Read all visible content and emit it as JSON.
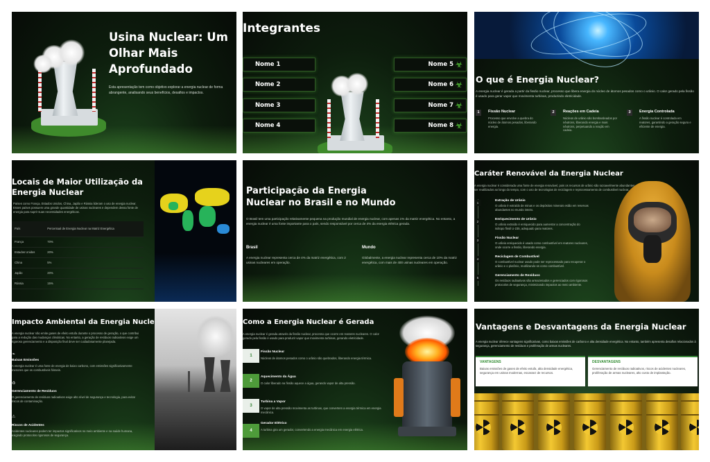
{
  "slides": {
    "s1": {
      "title": "Usina Nuclear: Um Olhar Mais Aprofundado",
      "subtitle": "Esta apresentação tem como objetivo explorar a energia nuclear de forma abrangente, analisando seus benefícios, desafios e impactos."
    },
    "s2": {
      "title": "Integrantes",
      "names": [
        "Nome 1",
        "Nome 2",
        "Nome 3",
        "Nome 4",
        "Nome 5",
        "Nome 6",
        "Nome 7",
        "Nome 8"
      ]
    },
    "s3": {
      "title": "O que é Energia Nuclear?",
      "desc": "A energia nuclear é gerada a partir da fissão nuclear, processo que libera energia do núcleo de átomos pesados como o urânio. O calor gerado pela fissão é usado para gerar vapor que movimenta turbinas, produzindo eletricidade.",
      "items": [
        {
          "n": "1",
          "h": "Fissão Nuclear",
          "d": "Processo que envolve a quebra do núcleo de átomos pesados, liberando energia."
        },
        {
          "n": "2",
          "h": "Reações em Cadeia",
          "d": "Núcleos de urânio são bombardeados por nêutrons, liberando energia e mais nêutrons, perpetuando a reação em cadeia."
        },
        {
          "n": "3",
          "h": "Energia Controlada",
          "d": "A fissão nuclear é controlada em reatores, garantindo a geração segura e eficiente de energia."
        }
      ]
    },
    "s4": {
      "title": "Locais de Maior Utilização da Energia Nuclear",
      "desc": "Países como França, Estados Unidos, China, Japão e Rússia lideram o uso de energia nuclear. Esses países possuem uma grande quantidade de usinas nucleares e dependem dessa fonte de energia para suprir suas necessidades energéticas.",
      "col1": "País",
      "col2": "Percentual de Energia Nuclear na Matriz Energética",
      "rows": [
        [
          "França",
          "70%"
        ],
        [
          "Estados Unidos",
          "20%"
        ],
        [
          "China",
          "5%"
        ],
        [
          "Japão",
          "20%"
        ],
        [
          "Rússia",
          "15%"
        ]
      ]
    },
    "s5": {
      "title": "Participação da Energia Nuclear no Brasil e no Mundo",
      "desc": "O Brasil tem uma participação relativamente pequena na produção mundial de energia nuclear, com apenas 1% da matriz energética. No entanto, a energia nuclear é uma fonte importante para o país, sendo responsável por cerca de 4% da energia elétrica gerada.",
      "brasil_h": "Brasil",
      "brasil_d": "A energia nuclear representa cerca de 4% da matriz energética, com 2 usinas nucleares em operação.",
      "mundo_h": "Mundo",
      "mundo_d": "Globalmente, a energia nuclear representa cerca de 10% da matriz energética, com mais de 400 usinas nucleares em operação."
    },
    "s6": {
      "title": "Caráter Renovável da Energia Nuclear",
      "desc": "A energia nuclear é considerada uma fonte de energia renovável, pois os recursos de urânio são razoavelmente abundantes e podem ser reutilizados ao longo do tempo, com o uso de tecnologias de reciclagem e reprocessamento de combustível nuclear.",
      "steps": [
        {
          "n": "1",
          "h": "Extração de Urânio",
          "d": "O urânio é extraído de minas e os depósitos minerais estão em reservas abundantes no mundo inteiro."
        },
        {
          "n": "2",
          "h": "Enriquecimento de Urânio",
          "d": "O urânio extraído é enriquecido para aumentar a concentração do isótopo físsil U-235, adequado para reatores."
        },
        {
          "n": "3",
          "h": "Fissão Nuclear",
          "d": "O urânio enriquecido é usado como combustível em reatores nucleares, onde ocorre a fissão, liberando energia."
        },
        {
          "n": "4",
          "h": "Reciclagem de Combustível",
          "d": "O combustível nuclear usado pode ser reprocessado para recuperar o urânio e o plutônio, reutilizando-os como combustível."
        },
        {
          "n": "5",
          "h": "Gerenciamento de Resíduos",
          "d": "Os resíduos radioativos são armazenados e gerenciados com rigorosos protocolos de segurança, minimizando impactos ao meio ambiente."
        }
      ]
    },
    "s7": {
      "title": "Impacto Ambiental da Energia Nuclear",
      "desc": "A energia nuclear não emite gases de efeito estufa durante o processo de geração, o que contribui para a redução das mudanças climáticas. No entanto, a geração de resíduos radioativos exige um rigoroso gerenciamento e a disposição final deve ser cuidadosamente planejada.",
      "items": [
        {
          "h": "Baixas Emissões",
          "d": "A energia nuclear é uma fonte de energia de baixo carbono, com emissões significativamente menores que os combustíveis fósseis."
        },
        {
          "h": "Gerenciamento de Resíduos",
          "d": "O gerenciamento de resíduos radioativos exige alto nível de segurança e tecnologia, para evitar riscos de contaminação."
        },
        {
          "h": "Riscos de Acidentes",
          "d": "Acidentes nucleares podem ter impactos significativos no meio ambiente e na saúde humana, exigindo protocolos rigorosos de segurança."
        }
      ]
    },
    "s8": {
      "title": "Como a Energia Nuclear é Gerada",
      "desc": "A energia nuclear é gerada através da fissão nuclear, processo que ocorre em reatores nucleares. O calor gerado pela fissão é usado para produzir vapor que movimenta turbinas, gerando eletricidade.",
      "steps": [
        {
          "n": "1",
          "h": "Fissão Nuclear",
          "d": "Núcleos de átomos pesados como o urânio são quebrados, liberando energia térmica."
        },
        {
          "n": "2",
          "h": "Aquecimento da Água",
          "d": "O calor liberado na fissão aquece a água, gerando vapor de alta pressão."
        },
        {
          "n": "3",
          "h": "Turbina a Vapor",
          "d": "O vapor de alta pressão movimenta as turbinas, que convertem a energia térmica em energia mecânica."
        },
        {
          "n": "4",
          "h": "Gerador Elétrico",
          "d": "A turbina gira um gerador, convertendo a energia mecânica em energia elétrica."
        }
      ]
    },
    "s9": {
      "title": "Vantagens e Desvantagens da Energia Nuclear",
      "desc": "A energia nuclear oferece vantagens significativas, como baixas emissões de carbono e alta densidade energética. No entanto, também apresenta desafios relacionados à segurança, gerenciamento de resíduos e proliferação de armas nucleares.",
      "adv_h": "VANTAGENS",
      "adv_d": "Baixas emissões de gases de efeito estufa, alta densidade energética, segurança em usinas modernas, escassez de recursos.",
      "dis_h": "DESVANTAGENS",
      "dis_d": "Gerenciamento de resíduos radioativos, riscos de acidentes nucleares, proliferação de armas nucleares, alto custo de implantação."
    }
  },
  "colors": {
    "accent": "#5bd63a",
    "bg": "#0a130a"
  }
}
